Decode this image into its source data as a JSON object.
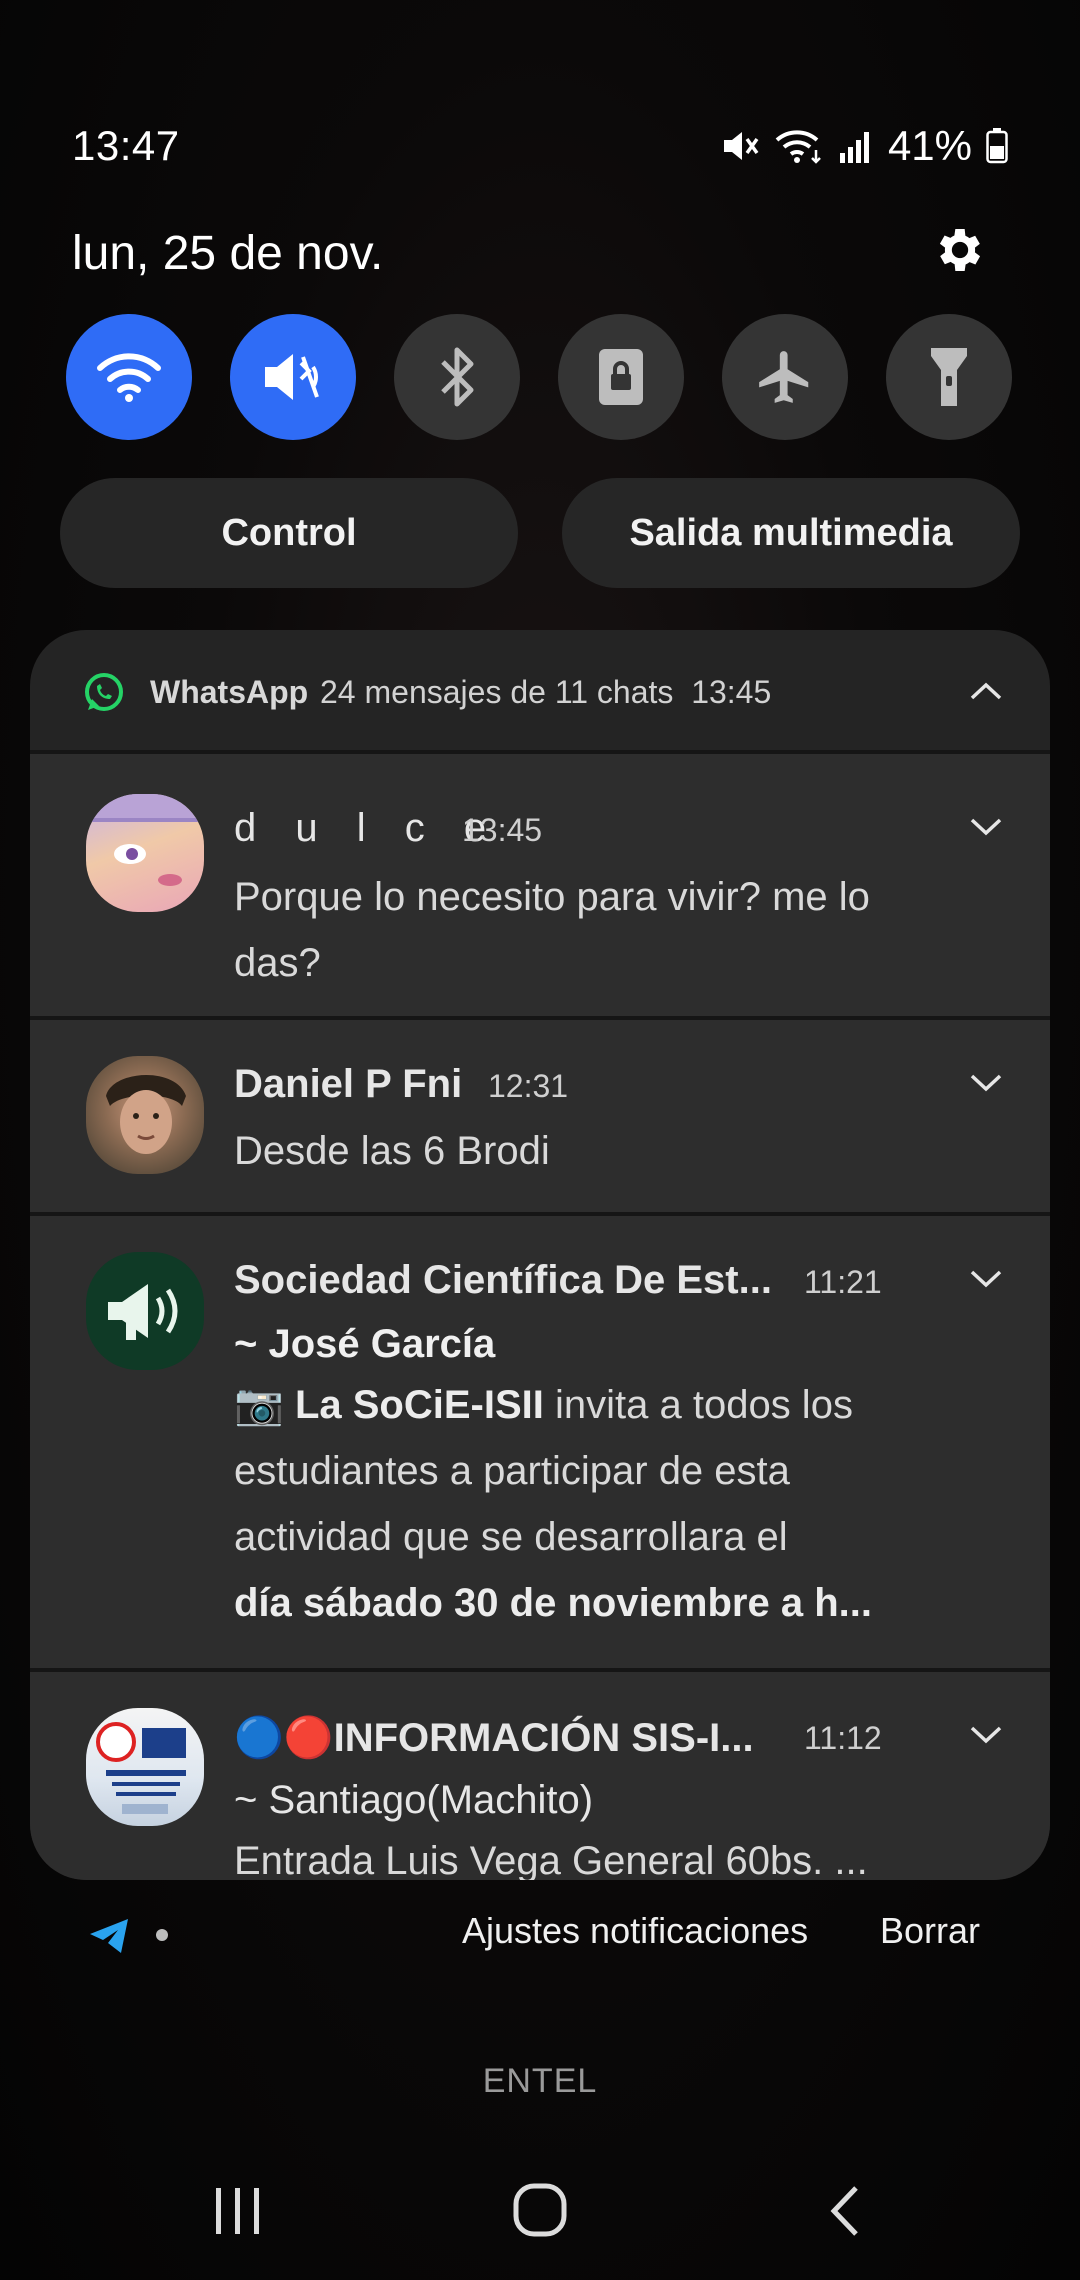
{
  "status_bar": {
    "time": "13:47",
    "battery": "41%"
  },
  "date": "lun, 25 de nov.",
  "quick_toggles": [
    {
      "name": "wifi-icon",
      "state": "on"
    },
    {
      "name": "sound-muted-icon",
      "state": "on"
    },
    {
      "name": "bluetooth-icon",
      "state": "off"
    },
    {
      "name": "screen-lock-icon",
      "state": "off"
    },
    {
      "name": "airplane-icon",
      "state": "off"
    },
    {
      "name": "flashlight-icon",
      "state": "off"
    }
  ],
  "buttons": {
    "control": "Control",
    "media_output": "Salida multimedia"
  },
  "notification_group": {
    "app_name": "WhatsApp",
    "summary": "24 mensajes de 11 chats",
    "time": "13:45"
  },
  "notifications": [
    {
      "sender": "d u l c e",
      "time": "13:45",
      "message": "Porque lo necesito para vivir? me lo das?"
    },
    {
      "sender": "Daniel P Fni",
      "time": "12:31",
      "message": "Desde las 6 Brodi"
    },
    {
      "sender": "Sociedad Científica De Est...",
      "time": "11:21",
      "sub_sender": "~ José García",
      "message_camera": "📷",
      "message_bold_1": "La SoCiE-ISII",
      "message_part_1": " invita a todos los estudiantes a participar de esta actividad que se desarrollara el",
      "message_bold_2": "día sábado 30 de noviembre a h..."
    },
    {
      "sender": "INFORMACIÓN SIS-I...",
      "sender_prefix_icons": "🔵🔴",
      "time": "11:12",
      "sub_sender": "~ Santiago(Machito)",
      "message": "Entrada Luis Vega General 60bs. ..."
    }
  ],
  "footer": {
    "settings": "Ajustes notificaciones",
    "clear": "Borrar",
    "carrier": "ENTEL"
  },
  "colors": {
    "accent": "#2f6cf6",
    "whatsapp": "#25d366",
    "telegram": "#2aa3ef"
  }
}
